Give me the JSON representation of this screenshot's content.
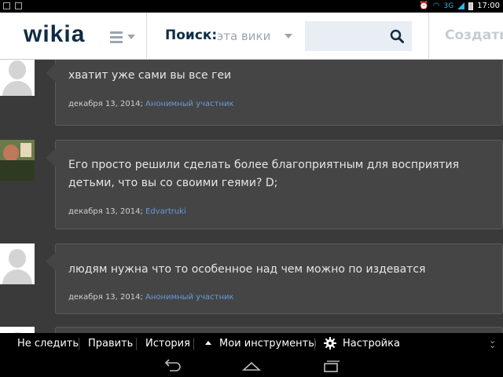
{
  "status_bar": {
    "network": "3G",
    "time": "17:00"
  },
  "header": {
    "logo": "wikia",
    "search_label": "Поиск:",
    "search_scope": "эта вики",
    "search_placeholder": "",
    "create_label": "Создать"
  },
  "comments": [
    {
      "text": "хватит уже сами вы все геи",
      "date": "декабря 13, 2014; ",
      "author": "Анонимный участник",
      "avatar": "default"
    },
    {
      "text": "Его просто решили сделать более благоприятным для восприятия детьми, что вы со своими геями? D;",
      "date": "декабря 13, 2014; ",
      "author": "Edvartruki",
      "avatar": "photo"
    },
    {
      "text": "людям нужна что то особенное над чем можно по издеватся",
      "date": "декабря 13, 2014; ",
      "author": "Анонимный участник",
      "avatar": "default"
    }
  ],
  "toolbar": {
    "unfollow": "Не следить",
    "edit": "Править",
    "history": "История",
    "my_tools": "Мои инструменты",
    "settings": "Настройка"
  },
  "colors": {
    "logo": "#0f2c45",
    "link": "#6b9ad8",
    "page_bg": "#3a3a3a",
    "bubble_bg": "#454545"
  }
}
